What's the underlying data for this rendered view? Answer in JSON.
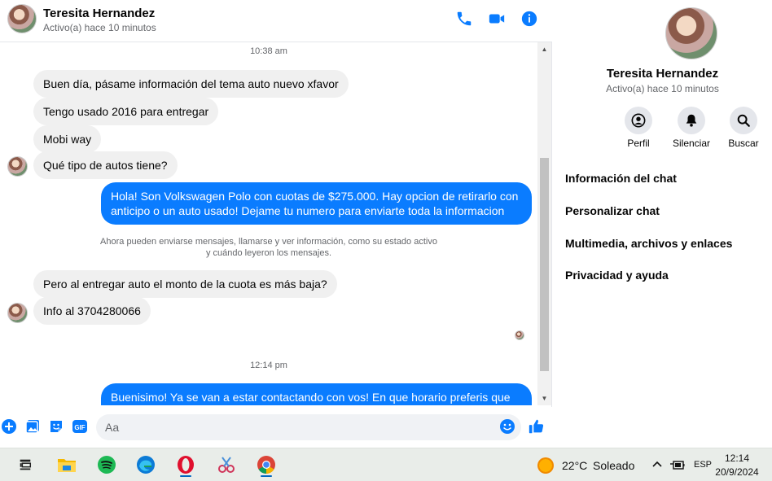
{
  "header": {
    "name": "Teresita Hernandez",
    "status": "Activo(a) hace 10 minutos",
    "icons": [
      "phone-icon",
      "video-camera-icon",
      "info-icon"
    ],
    "accent_color": "#0a7cff"
  },
  "messages": {
    "timestamp_1": "10:38 am",
    "incoming_1": "Buen día, pásame información del tema auto nuevo xfavor",
    "incoming_2": "Tengo usado 2016 para entregar",
    "incoming_3": "Mobi way",
    "incoming_4": "Qué tipo de autos tiene?",
    "outgoing_1": "Hola! Son Volkswagen Polo con cuotas de $275.000. Hay opcion de retirarlo con anticipo o un auto usado! Dejame tu numero para enviarte toda la informacion",
    "notice_line_1": "Ahora pueden enviarse mensajes, llamarse y ver información, como su estado activo",
    "notice_line_2": "y cuándo leyeron los mensajes.",
    "incoming_5": "Pero al entregar auto el monto de la cuota es más baja?",
    "incoming_6": "Info al 3704280066",
    "timestamp_2": "12:14 pm",
    "outgoing_2": "Buenisimo! Ya se van a estar contactando con vos! En que horario preferis que se"
  },
  "composer": {
    "placeholder": "Aa",
    "icons": [
      "plus-icon",
      "image-icon",
      "sticker-icon",
      "gif-icon",
      "emoji-icon",
      "like-icon"
    ]
  },
  "side_panel": {
    "name": "Teresita Hernandez",
    "status": "Activo(a) hace 10 minutos",
    "actions": [
      {
        "label": "Perfil",
        "icon": "profile-icon"
      },
      {
        "label": "Silenciar",
        "icon": "bell-icon"
      },
      {
        "label": "Buscar",
        "icon": "search-icon"
      }
    ],
    "menu": [
      "Información del chat",
      "Personalizar chat",
      "Multimedia, archivos y enlaces",
      "Privacidad y ayuda"
    ]
  },
  "taskbar": {
    "apps": [
      "task-view-icon",
      "file-explorer-icon",
      "spotify-icon",
      "edge-icon",
      "opera-icon",
      "snipping-tool-icon",
      "chrome-icon"
    ],
    "weather_temp": "22°C",
    "weather_desc": "Soleado",
    "language": "ESP",
    "time": "12:14",
    "date": "20/9/2024"
  }
}
